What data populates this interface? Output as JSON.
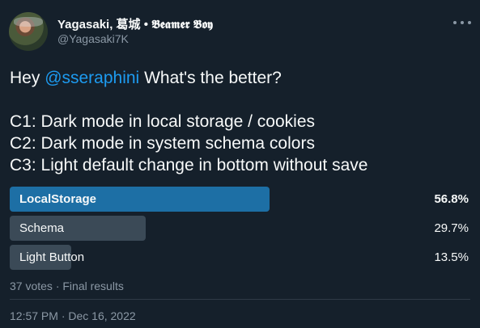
{
  "author": {
    "name": "Yagasaki, 葛城 • 𝕭𝖊𝖆𝖒𝖊𝖗 𝕭𝖔𝖞",
    "handle": "@Yagasaki7K"
  },
  "tweet": {
    "greeting_prefix": "Hey ",
    "mention": "@sseraphini",
    "greeting_suffix": " What's the better?",
    "lines": [
      "C1: Dark mode in local storage / cookies",
      "C2: Dark mode in system schema colors",
      "C3: Light default change in bottom without save"
    ]
  },
  "poll": {
    "options": [
      {
        "label": "LocalStorage",
        "percent_text": "56.8%",
        "percent": 56.8,
        "winner": true
      },
      {
        "label": "Schema",
        "percent_text": "29.7%",
        "percent": 29.7,
        "winner": false
      },
      {
        "label": "Light Button",
        "percent_text": "13.5%",
        "percent": 13.5,
        "winner": false
      }
    ],
    "summary": "37 votes · Final results"
  },
  "timestamp": "12:57 PM · Dec 16, 2022",
  "colors": {
    "background": "#15202b",
    "accent": "#1d9bf0",
    "winner_bar": "#1d6fa5",
    "other_bar": "#3b4a57"
  },
  "icons": {
    "more": "more-options-icon"
  }
}
